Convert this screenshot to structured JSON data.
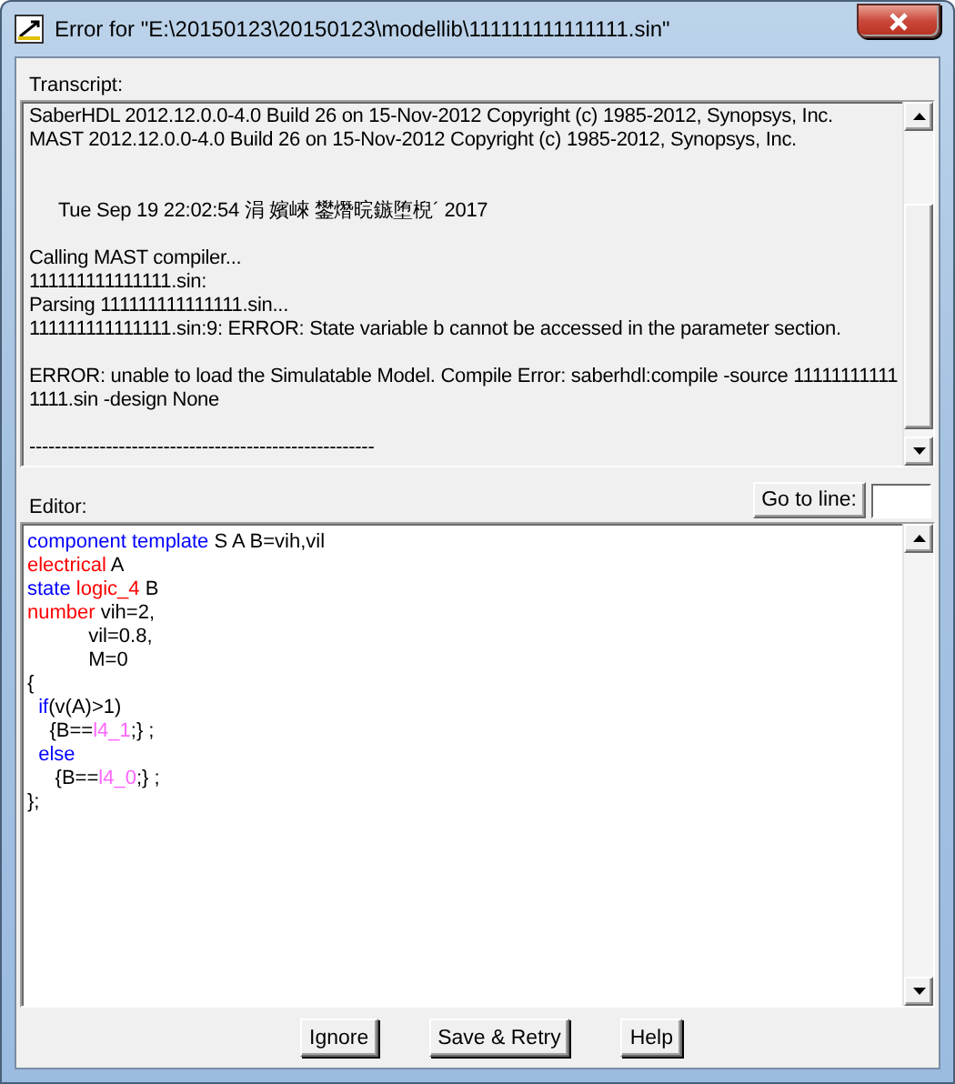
{
  "window": {
    "title": "Error for \"E:\\20150123\\20150123\\modellib\\111111111111111.sin\""
  },
  "transcript": {
    "label": "Transcript:",
    "blocks": [
      [
        "SaberHDL 2012.12.0.0-4.0 Build 26 on 15-Nov-2012 Copyright (c) 1985-2012, Synopsys, Inc.",
        "MAST 2012.12.0.0-4.0 Build 26 on 15-Nov-2012 Copyright (c) 1985-2012, Synopsys, Inc."
      ],
      [
        "Tue Sep 19 22:02:54 涓 嬪崍 鐢熸晥鏃堕棿´ 2017"
      ],
      [
        "Calling MAST compiler...",
        "111111111111111.sin:",
        "Parsing 111111111111111.sin...",
        "111111111111111.sin:9:  ERROR:  State variable b cannot be accessed in the parameter section."
      ],
      [
        "ERROR: unable to load the Simulatable Model. Compile Error: saberhdl:compile -source 11111111111",
        "1111.sin -design None"
      ],
      [
        "------------------------------------------------------"
      ]
    ]
  },
  "editor": {
    "label": "Editor:",
    "goto_button": "Go to line:",
    "lines": [
      [
        {
          "kind": "keyword",
          "text": "component template"
        },
        {
          "kind": "plain",
          "text": " S A B=vih,vil"
        }
      ],
      [
        {
          "kind": "type",
          "text": "electrical"
        },
        {
          "kind": "plain",
          "text": " A"
        }
      ],
      [
        {
          "kind": "keyword",
          "text": "state"
        },
        {
          "kind": "type",
          "text": " logic_4"
        },
        {
          "kind": "plain",
          "text": " B"
        }
      ],
      [
        {
          "kind": "type",
          "text": "number"
        },
        {
          "kind": "plain",
          "text": " vih=2,"
        }
      ],
      [
        {
          "kind": "plain",
          "text": "           vil=0.8,"
        }
      ],
      [
        {
          "kind": "plain",
          "text": "           M=0"
        }
      ],
      [
        {
          "kind": "plain",
          "text": "{"
        }
      ],
      [
        {
          "kind": "keyword",
          "text": "  if"
        },
        {
          "kind": "plain",
          "text": "(v(A)>1)"
        }
      ],
      [
        {
          "kind": "plain",
          "text": "    {B=="
        },
        {
          "kind": "constant",
          "text": "l4_1"
        },
        {
          "kind": "plain",
          "text": ";} ;"
        }
      ],
      [
        {
          "kind": "keyword",
          "text": "  else"
        }
      ],
      [
        {
          "kind": "plain",
          "text": "     {B=="
        },
        {
          "kind": "constant",
          "text": "l4_0"
        },
        {
          "kind": "plain",
          "text": ";} ;"
        }
      ],
      [
        {
          "kind": "plain",
          "text": "};"
        }
      ]
    ]
  },
  "buttons": [
    "Ignore",
    "Save & Retry",
    "Help"
  ]
}
